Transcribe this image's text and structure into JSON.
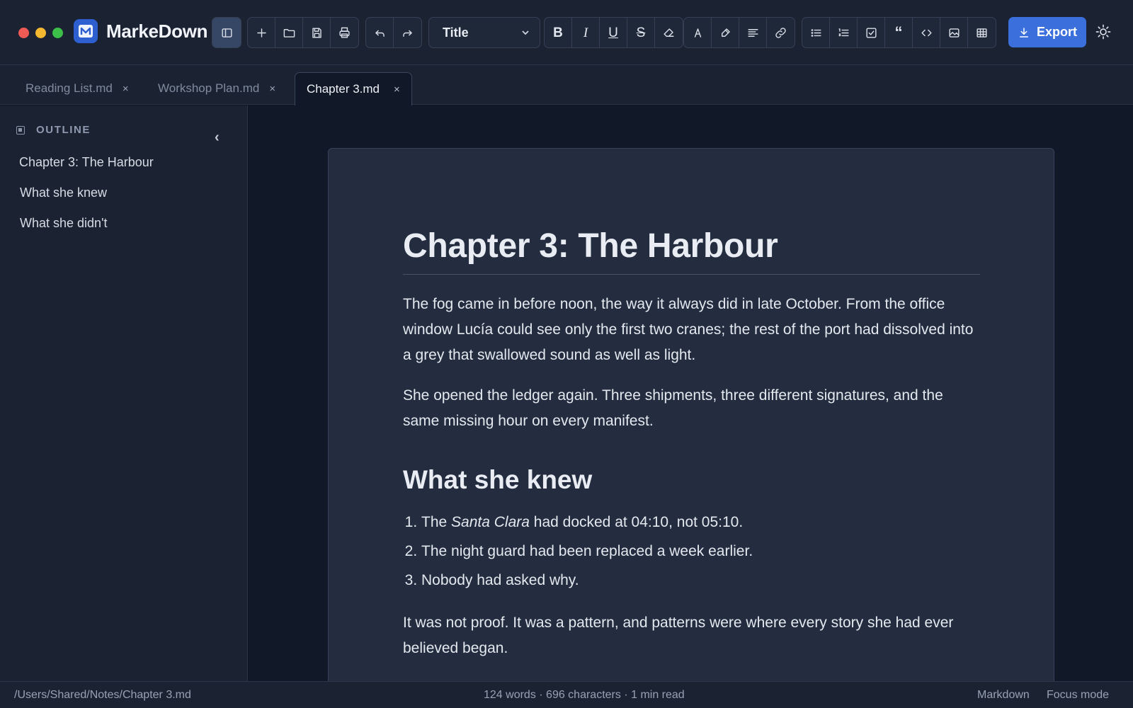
{
  "app": {
    "name": "MarkeDown",
    "logo_letter": "M",
    "accent": "#3a6fdc"
  },
  "toolbar": {
    "groups": [
      {
        "id": "sidebar",
        "buttons": [
          "sidebar-toggle-icon"
        ]
      },
      {
        "id": "file",
        "buttons": [
          "new-file-icon",
          "open-folder-icon",
          "save-icon",
          "print-icon"
        ]
      },
      {
        "id": "history",
        "buttons": [
          "undo-icon",
          "redo-icon"
        ]
      },
      {
        "id": "format",
        "buttons": [
          "bold-icon",
          "italic-icon",
          "underline-icon",
          "strikethrough-icon",
          "eraser-icon"
        ]
      },
      {
        "id": "style",
        "buttons": [
          "text-color-icon",
          "highlight-icon",
          "align-icon",
          "link-icon"
        ]
      },
      {
        "id": "insert",
        "buttons": [
          "bullet-list-icon",
          "numbered-list-icon",
          "checkbox-icon",
          "quote-icon",
          "code-icon",
          "image-icon",
          "table-icon"
        ]
      }
    ],
    "heading_select": {
      "value": "Title"
    },
    "export_label": "Export",
    "theme_icon": "sun-icon"
  },
  "tabs": [
    {
      "label": "Reading List.md",
      "close": "×",
      "active": false
    },
    {
      "label": "Workshop Plan.md",
      "close": "×",
      "active": false
    },
    {
      "label": "Chapter 3.md",
      "close": "×",
      "active": true
    }
  ],
  "sidebar": {
    "heading": "OUTLINE",
    "collapse_glyph": "‹",
    "items": [
      {
        "label": "Chapter 3: The Harbour"
      },
      {
        "label": "What she knew"
      },
      {
        "label": "What she didn't"
      }
    ]
  },
  "document": {
    "title": "Chapter 3: The Harbour",
    "p1": "The fog came in before noon, the way it always did in late October. From the office window Lucía could see only the first two cranes; the rest of the port had dissolved into a grey that swallowed sound as well as light.",
    "p2": "She opened the ledger again. Three shipments, three different signatures, and the same missing hour on every manifest.",
    "h2": "What she knew",
    "list": [
      {
        "pre": "The ",
        "em": "Santa Clara",
        "post": " had docked at 04:10, not 05:10."
      },
      {
        "pre": "The night guard had been replaced a week earlier.",
        "em": "",
        "post": ""
      },
      {
        "pre": "Nobody had asked why.",
        "em": "",
        "post": ""
      }
    ],
    "p3": "It was not proof. It was a pattern, and patterns were where every story she had ever believed began."
  },
  "status": {
    "path": "/Users/Shared/Notes/Chapter 3.md",
    "stats": "124 words · 696 characters · 1 min read",
    "mode": "Markdown",
    "focus": "Focus mode"
  }
}
